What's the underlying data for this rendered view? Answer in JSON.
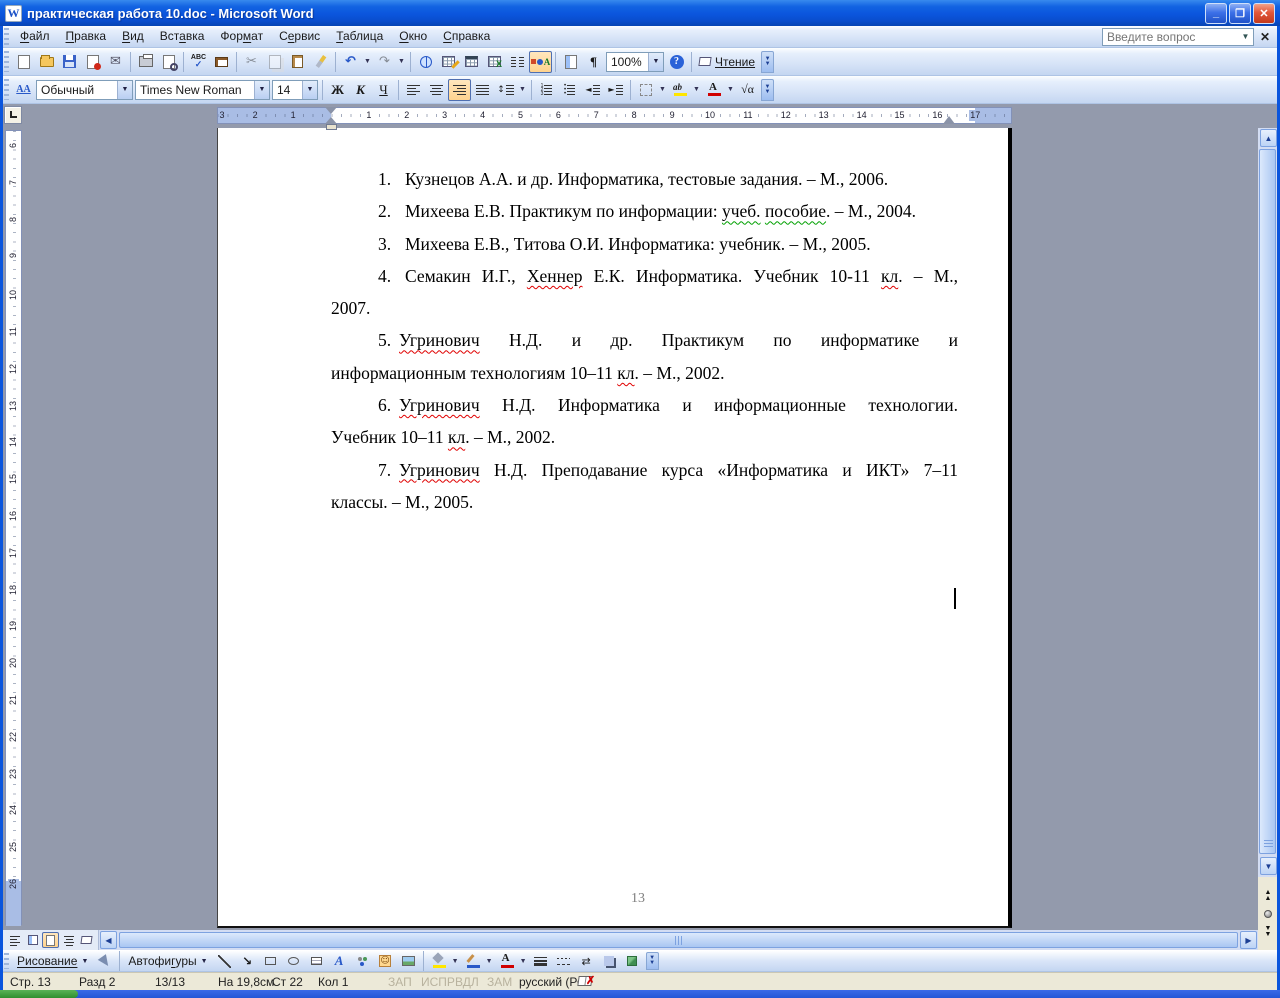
{
  "window": {
    "title": "практическая работа 10.doc - Microsoft Word",
    "buttons": {
      "minimize": "_",
      "restore": "❐",
      "close": "✕"
    }
  },
  "colors": {
    "titlebar_blue": "#0b55dd",
    "active_button_bg": "#ffd38e",
    "workspace_gray": "#939aac",
    "status_bg": "#ece9d8",
    "squiggle_red": "#e00000",
    "squiggle_green": "#00a000",
    "taskbar_green": "#2f8f2f"
  },
  "menu": {
    "items": [
      {
        "id": "file",
        "pre": "",
        "ac": "Ф",
        "post": "айл"
      },
      {
        "id": "edit",
        "pre": "",
        "ac": "П",
        "post": "равка"
      },
      {
        "id": "view",
        "pre": "",
        "ac": "В",
        "post": "ид"
      },
      {
        "id": "insert",
        "pre": "Вст",
        "ac": "а",
        "post": "вка"
      },
      {
        "id": "format",
        "pre": "Фор",
        "ac": "м",
        "post": "ат"
      },
      {
        "id": "tools",
        "pre": "С",
        "ac": "е",
        "post": "рвис"
      },
      {
        "id": "table",
        "pre": "",
        "ac": "Т",
        "post": "аблица"
      },
      {
        "id": "window",
        "pre": "",
        "ac": "О",
        "post": "кно"
      },
      {
        "id": "help",
        "pre": "",
        "ac": "С",
        "post": "правка"
      }
    ],
    "question_placeholder": "Введите вопрос"
  },
  "toolbars": {
    "standard": {
      "zoom_value": "100%",
      "read_label": "Чтение",
      "icons": [
        "new-document",
        "open",
        "save",
        "permission",
        "email",
        "print",
        "print-preview",
        "spelling",
        "research",
        "cut",
        "copy",
        "paste",
        "format-painter",
        "undo",
        "redo",
        "insert-hyperlink",
        "tables-and-borders",
        "insert-table",
        "insert-excel-table",
        "columns",
        "drawing",
        "document-map",
        "show-formatting-marks",
        "zoom",
        "help",
        "read-mode"
      ]
    },
    "formatting": {
      "styles_icon": "АА",
      "style_value": "Обычный",
      "font_value": "Times New Roman",
      "size_value": "14",
      "bold": "Ж",
      "italic": "К",
      "underline": "Ч",
      "equation": "√α",
      "highlight_letters": "ab",
      "fontcolor_letter": "А",
      "icons": [
        "styles-and-formatting",
        "style-combo",
        "font-combo",
        "size-combo",
        "bold",
        "italic",
        "underline",
        "align-left",
        "align-center",
        "align-right",
        "justify",
        "line-spacing",
        "numbering",
        "bullets",
        "decrease-indent",
        "increase-indent",
        "borders",
        "highlight",
        "font-color",
        "equation-editor"
      ]
    }
  },
  "ruler": {
    "h_margin_numbers": [
      "3",
      "2",
      "1"
    ],
    "h_numbers": [
      "1",
      "2",
      "3",
      "4",
      "5",
      "6",
      "7",
      "8",
      "9",
      "10",
      "11",
      "12",
      "13",
      "14",
      "15",
      "16",
      "17"
    ],
    "v_numbers": [
      "6",
      "7",
      "8",
      "9",
      "10",
      "11",
      "12",
      "13",
      "14",
      "15",
      "16",
      "17",
      "18",
      "19",
      "20",
      "21",
      "22",
      "23",
      "24",
      "25",
      "26"
    ]
  },
  "document": {
    "page_number": "13",
    "paragraphs": [
      {
        "number": "1.",
        "lines": [
          {
            "j": false,
            "s": [
              {
                "t": "Кузнецов А.А. и др. Информатика, тестовые задания. – М., 2006."
              }
            ]
          }
        ]
      },
      {
        "number": "2.",
        "lines": [
          {
            "j": false,
            "s": [
              {
                "t": "Михеева Е.В. Практикум по информации: "
              },
              {
                "t": "учеб.",
                "sq": "green"
              },
              {
                "t": " "
              },
              {
                "t": "пособие",
                "sq": "green"
              },
              {
                "t": ". – М., 2004."
              }
            ]
          }
        ]
      },
      {
        "number": "3.",
        "lines": [
          {
            "j": false,
            "s": [
              {
                "t": "Михеева Е.В., Титова О.И. Информатика: учебник. – М., 2005."
              }
            ]
          }
        ]
      },
      {
        "number": "4.",
        "lines": [
          {
            "j": true,
            "s": [
              {
                "t": "Семакин И.Г., "
              },
              {
                "t": "Хеннер",
                "sq": "red"
              },
              {
                "t": " Е.К. Информатика. Учебник 10-11 "
              },
              {
                "t": "кл",
                "sq": "red"
              },
              {
                "t": ". – М.,"
              }
            ]
          },
          {
            "j": false,
            "s": [
              {
                "t": "2007."
              }
            ]
          }
        ]
      },
      {
        "number": "5.",
        "lines": [
          {
            "j": true,
            "s": [
              {
                "t": "Угринович",
                "sq": "red"
              },
              {
                "t": " Н.Д. и др. Практикум по информатике и"
              }
            ]
          },
          {
            "j": false,
            "s": [
              {
                "t": "информационным технологиям 10–11 "
              },
              {
                "t": "кл",
                "sq": "red"
              },
              {
                "t": ". – М., 2002."
              }
            ]
          }
        ]
      },
      {
        "number": "6.",
        "lines": [
          {
            "j": true,
            "s": [
              {
                "t": "Угринович",
                "sq": "red"
              },
              {
                "t": " Н.Д. Информатика и информационные технологии."
              }
            ]
          },
          {
            "j": false,
            "s": [
              {
                "t": "Учебник 10–11 "
              },
              {
                "t": "кл",
                "sq": "red"
              },
              {
                "t": ". – М., 2002."
              }
            ]
          }
        ]
      },
      {
        "number": "7.",
        "lines": [
          {
            "j": true,
            "s": [
              {
                "t": "Угринович",
                "sq": "red"
              },
              {
                "t": " Н.Д. Преподавание курса «Информатика и ИКТ» 7–11"
              }
            ]
          },
          {
            "j": false,
            "s": [
              {
                "t": "классы. – М., 2005."
              }
            ]
          }
        ]
      }
    ]
  },
  "view_buttons": [
    "normal-view",
    "web-layout-view",
    "print-layout-view",
    "outline-view",
    "reading-view"
  ],
  "drawing_toolbar": {
    "draw_pre": "Рисование",
    "draw_ac": "",
    "autoshapes_pre": "Автофи",
    "autoshapes_ac": "г",
    "autoshapes_post": "уры",
    "icons": [
      "select-objects",
      "autoshapes",
      "line",
      "arrow",
      "rectangle",
      "oval",
      "text-box",
      "wordart",
      "diagram",
      "clip-art",
      "picture",
      "fill-color",
      "line-color",
      "font-color",
      "line-style",
      "dash-style",
      "arrow-style",
      "shadow-style",
      "3d-style"
    ],
    "wordart_letter": "А",
    "fontcolor_letter": "А"
  },
  "status_bar": {
    "fields": [
      "Стр. 13",
      "Разд 2",
      "13/13",
      "На 19,8см",
      "Ст 22",
      "Кол 1"
    ],
    "toggles": [
      "ЗАП",
      "ИСПР",
      "ВДЛ",
      "ЗАМ"
    ],
    "language": "русский (Ро"
  }
}
